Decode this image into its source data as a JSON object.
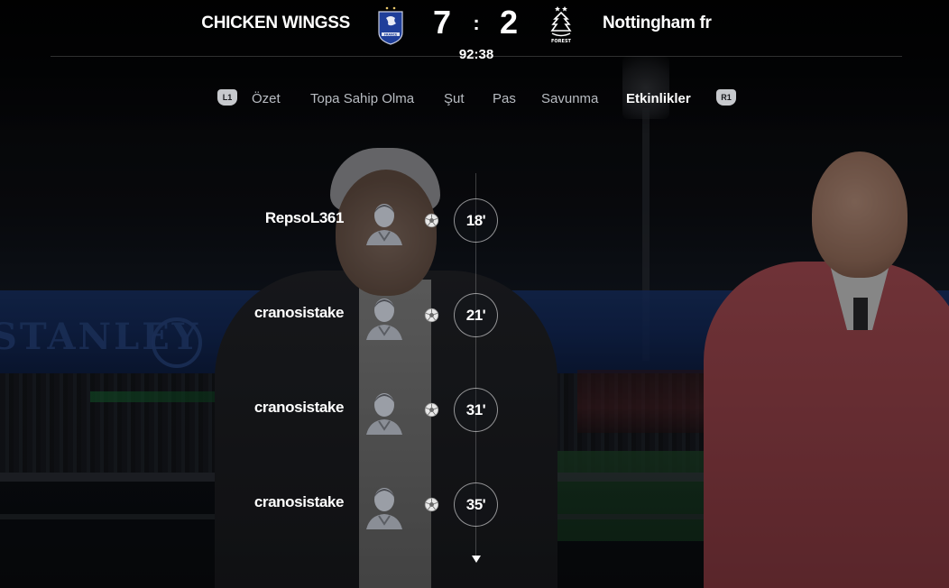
{
  "match": {
    "home_team": "CHICKEN WINGSS",
    "home_crest_icon": "france-crest-icon",
    "home_crest_text": "FRANCE",
    "home_score": "7",
    "separator": ":",
    "away_score": "2",
    "away_team": "Nottingham fr",
    "away_crest_icon": "nottingham-forest-crest-icon",
    "away_crest_text": "FOREST",
    "clock": "92:38"
  },
  "tabs": {
    "left_hint": "L1",
    "right_hint": "R1",
    "items": [
      {
        "label": "Özet"
      },
      {
        "label": "Topa Sahip Olma"
      },
      {
        "label": "Şut"
      },
      {
        "label": "Pas"
      },
      {
        "label": "Savunma"
      },
      {
        "label": "Etkinlikler"
      }
    ],
    "active": "Etkinlikler"
  },
  "events": [
    {
      "player": "RepsoL361",
      "type_icon": "ball-icon",
      "minute": "18'"
    },
    {
      "player": "cranosistake",
      "type_icon": "ball-icon",
      "minute": "21'"
    },
    {
      "player": "cranosistake",
      "type_icon": "ball-icon",
      "minute": "31'"
    },
    {
      "player": "cranosistake",
      "type_icon": "ball-icon",
      "minute": "35'"
    }
  ],
  "colors": {
    "text": "#ffffff",
    "tab_inactive": "#b8bcc2",
    "button_hint": "#c7c9cd"
  }
}
